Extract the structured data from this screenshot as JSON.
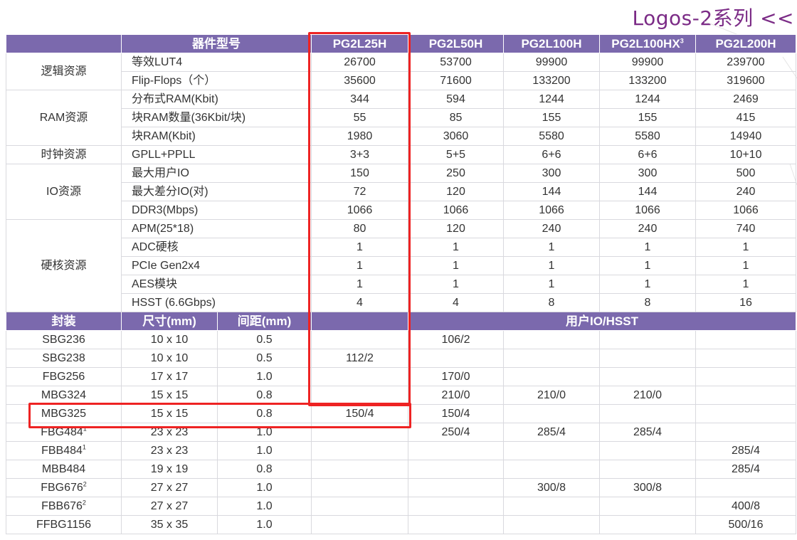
{
  "brand": {
    "title": "Logos-2系列",
    "chevrons": "<<"
  },
  "header": {
    "label": "器件型号",
    "models": [
      {
        "name": "PG2L25H",
        "sup": ""
      },
      {
        "name": "PG2L50H",
        "sup": ""
      },
      {
        "name": "PG2L100H",
        "sup": ""
      },
      {
        "name": "PG2L100HX",
        "sup": "3"
      },
      {
        "name": "PG2L200H",
        "sup": ""
      }
    ]
  },
  "resources": [
    {
      "category": "逻辑资源",
      "rows": [
        {
          "item": "等效LUT4",
          "values": [
            "26700",
            "53700",
            "99900",
            "99900",
            "239700"
          ]
        },
        {
          "item": "Flip-Flops（个）",
          "values": [
            "35600",
            "71600",
            "133200",
            "133200",
            "319600"
          ]
        }
      ]
    },
    {
      "category": "RAM资源",
      "rows": [
        {
          "item": "分布式RAM(Kbit)",
          "values": [
            "344",
            "594",
            "1244",
            "1244",
            "2469"
          ]
        },
        {
          "item": "块RAM数量(36Kbit/块)",
          "values": [
            "55",
            "85",
            "155",
            "155",
            "415"
          ]
        },
        {
          "item": "块RAM(Kbit)",
          "values": [
            "1980",
            "3060",
            "5580",
            "5580",
            "14940"
          ]
        }
      ]
    },
    {
      "category": "时钟资源",
      "rows": [
        {
          "item": "GPLL+PPLL",
          "values": [
            "3+3",
            "5+5",
            "6+6",
            "6+6",
            "10+10"
          ]
        }
      ]
    },
    {
      "category": "IO资源",
      "rows": [
        {
          "item": "最大用户IO",
          "values": [
            "150",
            "250",
            "300",
            "300",
            "500"
          ]
        },
        {
          "item": "最大差分IO(对)",
          "values": [
            "72",
            "120",
            "144",
            "144",
            "240"
          ]
        },
        {
          "item": "DDR3(Mbps)",
          "values": [
            "1066",
            "1066",
            "1066",
            "1066",
            "1066"
          ]
        }
      ]
    },
    {
      "category": "硬核资源",
      "rows": [
        {
          "item": "APM(25*18)",
          "values": [
            "80",
            "120",
            "240",
            "240",
            "740"
          ]
        },
        {
          "item": "ADC硬核",
          "values": [
            "1",
            "1",
            "1",
            "1",
            "1"
          ]
        },
        {
          "item": "PCIe Gen2x4",
          "values": [
            "1",
            "1",
            "1",
            "1",
            "1"
          ]
        },
        {
          "item": "AES模块",
          "values": [
            "1",
            "1",
            "1",
            "1",
            "1"
          ]
        },
        {
          "item": "HSST (6.6Gbps)",
          "values": [
            "4",
            "4",
            "8",
            "8",
            "16"
          ]
        }
      ]
    }
  ],
  "package_header": {
    "package": "封装",
    "size": "尺寸(mm)",
    "pitch": "间距(mm)",
    "io": "用户IO/HSST"
  },
  "packages": [
    {
      "name": "SBG236",
      "sup": "",
      "size": "10 x 10",
      "pitch": "0.5",
      "values": [
        "",
        "106/2",
        "",
        "",
        ""
      ]
    },
    {
      "name": "SBG238",
      "sup": "",
      "size": "10 x 10",
      "pitch": "0.5",
      "values": [
        "112/2",
        "",
        "",
        "",
        ""
      ]
    },
    {
      "name": "FBG256",
      "sup": "",
      "size": "17 x 17",
      "pitch": "1.0",
      "values": [
        "",
        "170/0",
        "",
        "",
        ""
      ]
    },
    {
      "name": "MBG324",
      "sup": "",
      "size": "15 x 15",
      "pitch": "0.8",
      "values": [
        "",
        "210/0",
        "210/0",
        "210/0",
        ""
      ]
    },
    {
      "name": "MBG325",
      "sup": "",
      "size": "15 x 15",
      "pitch": "0.8",
      "values": [
        "150/4",
        "150/4",
        "",
        "",
        ""
      ]
    },
    {
      "name": "FBG484",
      "sup": "1",
      "size": "23 x 23",
      "pitch": "1.0",
      "values": [
        "",
        "250/4",
        "285/4",
        "285/4",
        ""
      ]
    },
    {
      "name": "FBB484",
      "sup": "1",
      "size": "23 x 23",
      "pitch": "1.0",
      "values": [
        "",
        "",
        "",
        "",
        "285/4"
      ]
    },
    {
      "name": "MBB484",
      "sup": "",
      "size": "19 x 19",
      "pitch": "0.8",
      "values": [
        "",
        "",
        "",
        "",
        "285/4"
      ]
    },
    {
      "name": "FBG676",
      "sup": "2",
      "size": "27 x 27",
      "pitch": "1.0",
      "values": [
        "",
        "",
        "300/8",
        "300/8",
        ""
      ]
    },
    {
      "name": "FBB676",
      "sup": "2",
      "size": "27 x 27",
      "pitch": "1.0",
      "values": [
        "",
        "",
        "",
        "",
        "400/8"
      ]
    },
    {
      "name": "FFBG1156",
      "sup": "",
      "size": "35 x 35",
      "pitch": "1.0",
      "values": [
        "",
        "",
        "",
        "",
        "500/16"
      ]
    }
  ],
  "colors": {
    "header_bg": "#7b69ad",
    "brand": "#7b2b86",
    "highlight": "#ee2323",
    "grid": "#d9d9de"
  }
}
